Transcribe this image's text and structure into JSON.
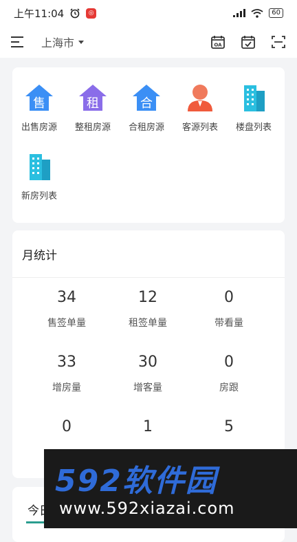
{
  "status_bar": {
    "time": "上午11:04",
    "battery": "60"
  },
  "top_bar": {
    "city": "上海市"
  },
  "quick_menu": [
    {
      "label": "出售房源",
      "glyph": "售",
      "icon": "sale-house-icon",
      "color": "#3b8ff5"
    },
    {
      "label": "整租房源",
      "glyph": "租",
      "icon": "rent-house-icon",
      "color": "#8a6de9"
    },
    {
      "label": "合租房源",
      "glyph": "合",
      "icon": "shared-rent-house-icon",
      "color": "#3b8ff5"
    },
    {
      "label": "客源列表",
      "glyph": "",
      "icon": "customer-person-icon",
      "color": "#f05a3c"
    },
    {
      "label": "楼盘列表",
      "glyph": "",
      "icon": "building-icon",
      "color": "#2bbfe0"
    },
    {
      "label": "新房列表",
      "glyph": "",
      "icon": "new-building-icon",
      "color": "#2bbfe0"
    }
  ],
  "monthly_stats": {
    "title": "月统计",
    "items": [
      {
        "value": "34",
        "label": "售签单量"
      },
      {
        "value": "12",
        "label": "租签单量"
      },
      {
        "value": "0",
        "label": "带看量"
      },
      {
        "value": "33",
        "label": "增房量"
      },
      {
        "value": "30",
        "label": "增客量"
      },
      {
        "value": "0",
        "label": "房跟"
      },
      {
        "value": "0",
        "label": ""
      },
      {
        "value": "1",
        "label": ""
      },
      {
        "value": "5",
        "label": ""
      }
    ]
  },
  "today": {
    "tab": "今日"
  },
  "watermark": {
    "brand": "592软件园",
    "url": "www.592xiazai.com"
  }
}
